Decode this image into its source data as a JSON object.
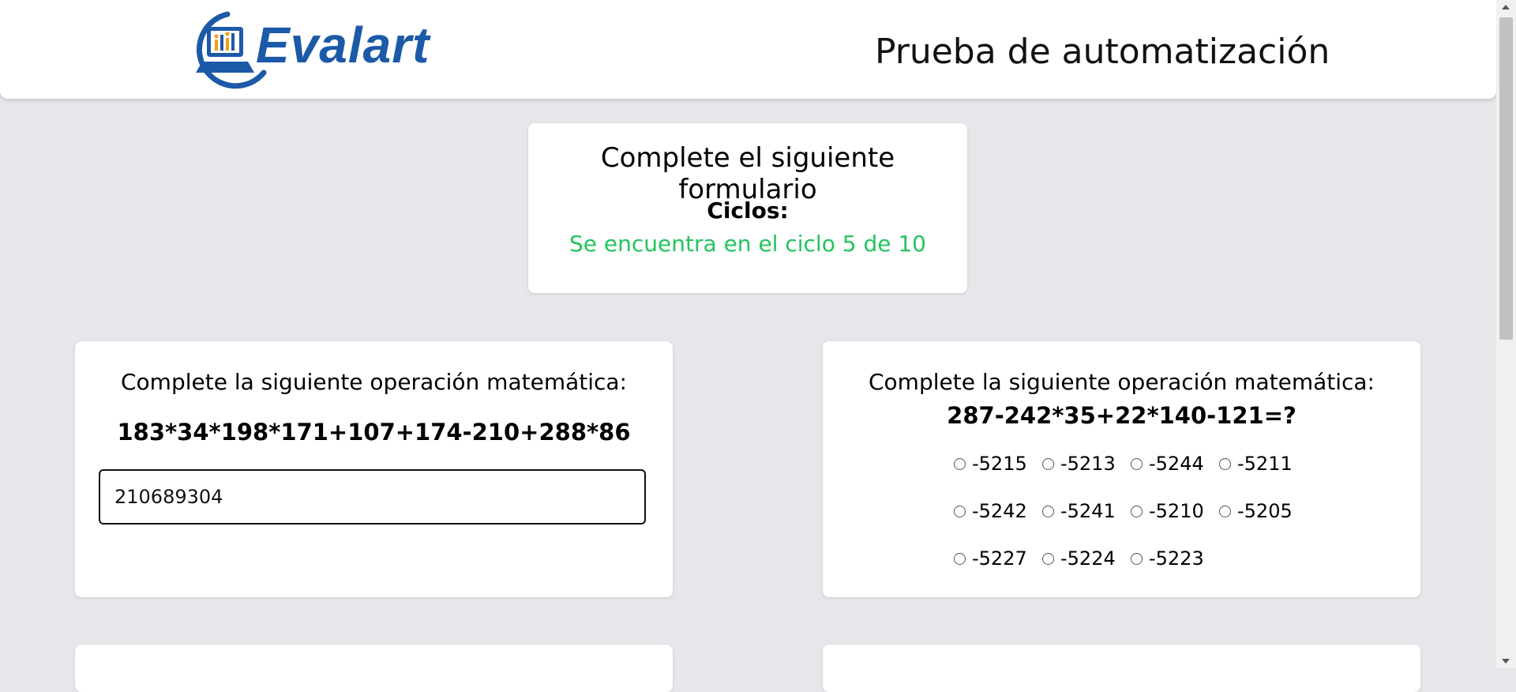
{
  "header": {
    "logo_text": "Evalart",
    "title": "Prueba de automatización"
  },
  "info": {
    "title": "Complete el siguiente formulario",
    "cycles_label": "Ciclos:",
    "cycles_value": "Se encuentra en el ciclo 5 de 10",
    "cycles_color": "#22c55e"
  },
  "question1": {
    "prompt": "Complete la siguiente operación matemática:",
    "expression": "183*34*198*171+107+174-210+288*86",
    "answer_value": "210689304"
  },
  "question2": {
    "prompt": "Complete la siguiente operación matemática:",
    "expression": "287-242*35+22*140-121=?",
    "options": [
      "-5215",
      "-5213",
      "-5244",
      "-5211",
      "-5242",
      "-5241",
      "-5210",
      "-5205",
      "-5227",
      "-5224",
      "-5223"
    ]
  },
  "colors": {
    "background": "#e5e7eb",
    "brand": "#1c5aa8",
    "success": "#22c55e"
  }
}
